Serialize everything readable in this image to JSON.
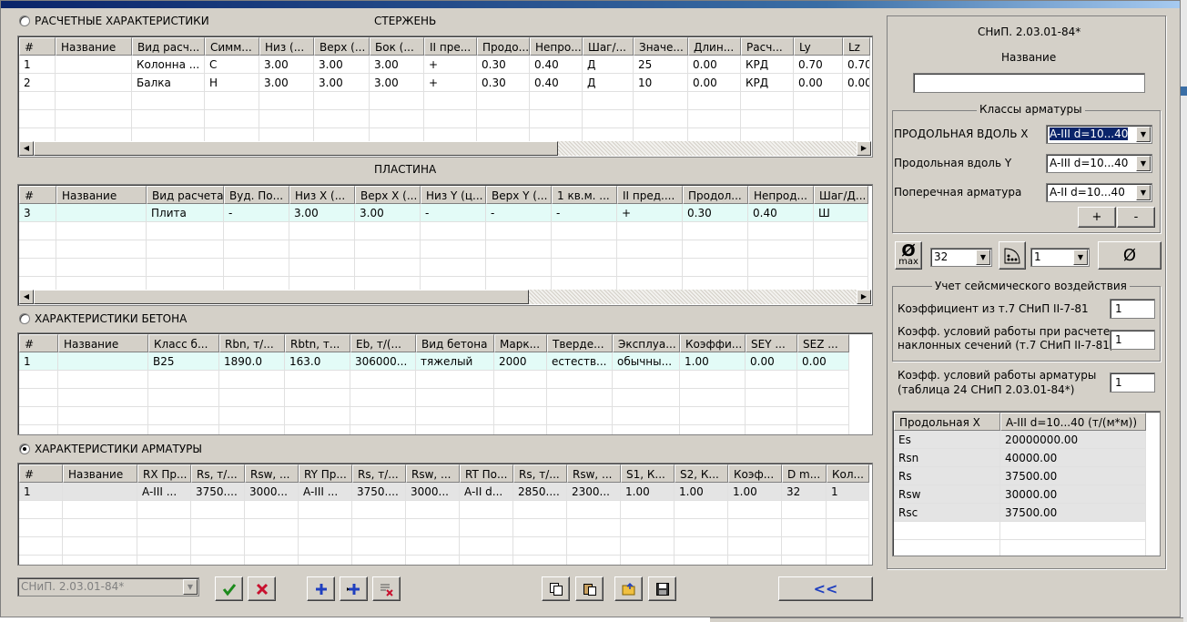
{
  "sections": {
    "calc_radio": "РАСЧЕТНЫЕ ХАРАКТЕРИСТИКИ",
    "rod_title": "СТЕРЖЕНЬ",
    "plate_title": "ПЛАСТИНА",
    "concrete_radio": "ХАРАКТЕРИСТИКИ БЕТОНА",
    "rebar_radio": "ХАРАКТЕРИСТИКИ АРМАТУРЫ"
  },
  "rod_table": {
    "headers": [
      "#",
      "Название",
      "Вид расч...",
      "Симм...",
      "Низ (...",
      "Верх (...",
      "Бок (...",
      "II пре...",
      "Продо...",
      "Непро...",
      "Шаг/...",
      "Значе...",
      "Длин...",
      "Расч...",
      "Ly",
      "Lz"
    ],
    "rows": [
      [
        "1",
        "",
        "Колонна ...",
        "С",
        "3.00",
        "3.00",
        "3.00",
        "+",
        "0.30",
        "0.40",
        "Д",
        "25",
        "0.00",
        "КРД",
        "0.70",
        "0.70"
      ],
      [
        "2",
        "",
        "Балка",
        "Н",
        "3.00",
        "3.00",
        "3.00",
        "+",
        "0.30",
        "0.40",
        "Д",
        "10",
        "0.00",
        "КРД",
        "0.00",
        "0.00"
      ]
    ]
  },
  "plate_table": {
    "headers": [
      "#",
      "Название",
      "Вид расчета",
      "Вуд. По...",
      "Низ X (...",
      "Верх X (...",
      "Низ Y (ц...",
      "Верх Y (...",
      "1 кв.м. ...",
      "II пред....",
      "Продол...",
      "Непрод...",
      "Шаг/Д..."
    ],
    "rows": [
      [
        "3",
        "",
        "Плита",
        "-",
        "3.00",
        "3.00",
        "-",
        "-",
        "-",
        "+",
        "0.30",
        "0.40",
        "Ш"
      ]
    ]
  },
  "concrete_table": {
    "headers": [
      "#",
      "Название",
      "Класс б...",
      "Rbn, т/...",
      "Rbtn, т...",
      "Eb, т/(...",
      "Вид бетона",
      "Марк...",
      "Тверде...",
      "Эксплуа...",
      "Коэффи...",
      "SEY ...",
      "SEZ ..."
    ],
    "rows": [
      [
        "1",
        "",
        "B25",
        "1890.0",
        "163.0",
        "306000...",
        "тяжелый",
        "2000",
        "естеств...",
        "обычны...",
        "1.00",
        "0.00",
        "0.00"
      ]
    ]
  },
  "rebar_table": {
    "headers": [
      "#",
      "Название",
      "RX Пр...",
      "Rs, т/...",
      "Rsw, ...",
      "RY Пр...",
      "Rs, т/...",
      "Rsw, ...",
      "RT По...",
      "Rs, т/...",
      "Rsw, ...",
      "S1, К...",
      "S2, К...",
      "Коэф...",
      "D m...",
      "Кол..."
    ],
    "rows": [
      [
        "1",
        "",
        "A-III ...",
        "3750....",
        "3000...",
        "A-III ...",
        "3750....",
        "3000...",
        "A-II d...",
        "2850....",
        "2300...",
        "1.00",
        "1.00",
        "1.00",
        "32",
        "1"
      ]
    ]
  },
  "bottom": {
    "norm_combo": "СНиП. 2.03.01-84*",
    "collapse_label": "<<"
  },
  "right": {
    "norm_title": "СНиП. 2.03.01-84*",
    "name_label": "Название",
    "name_value": "",
    "rebar_classes_title": "Классы арматуры",
    "long_x_label": "ПРОДОЛЬНАЯ ВДОЛЬ X",
    "long_x_value": "A-III d=10...40",
    "long_y_label": "Продольная вдоль Y",
    "long_y_value": "A-III d=10...40",
    "trans_label": "Поперечная арматура",
    "trans_value": "A-II d=10...40",
    "plus_label": "+",
    "minus_label": "-",
    "max_label": "max",
    "diameter_value": "32",
    "count_value": "1",
    "diam_symbol": "Ø",
    "seismic_title": "Учет сейсмического  воздействия",
    "seismic_coef_label": "Коэффициент из т.7 СНиП II-7-81",
    "seismic_coef_value": "1",
    "seismic_work_label_1": "Коэфф. условий работы при расчете",
    "seismic_work_label_2": "наклонных сечений (т.7 СНиП II-7-81)",
    "seismic_work_value": "1",
    "rebar_work_label_1": "Коэфф. условий работы арматуры",
    "rebar_work_label_2": "(таблица 24 СНиП 2.03.01-84*)",
    "rebar_work_value": "1",
    "props_header": [
      "Продольная  X",
      "A-III d=10...40 (т/(м*м))"
    ],
    "props_rows": [
      [
        "Es",
        "20000000.00"
      ],
      [
        "Rsn",
        "40000.00"
      ],
      [
        "Rs",
        "37500.00"
      ],
      [
        "Rsw",
        "30000.00"
      ],
      [
        "Rsc",
        "37500.00"
      ]
    ]
  },
  "colors": {
    "window_bg": "#d4d0c8",
    "row_selected": "#e3fbf7",
    "row_selected_gray": "#e4e4e4",
    "combo_selected": "#0a246a",
    "ok_green": "#1c8a1c",
    "cancel_red": "#c8102e",
    "add_blue": "#1f3fbf"
  }
}
